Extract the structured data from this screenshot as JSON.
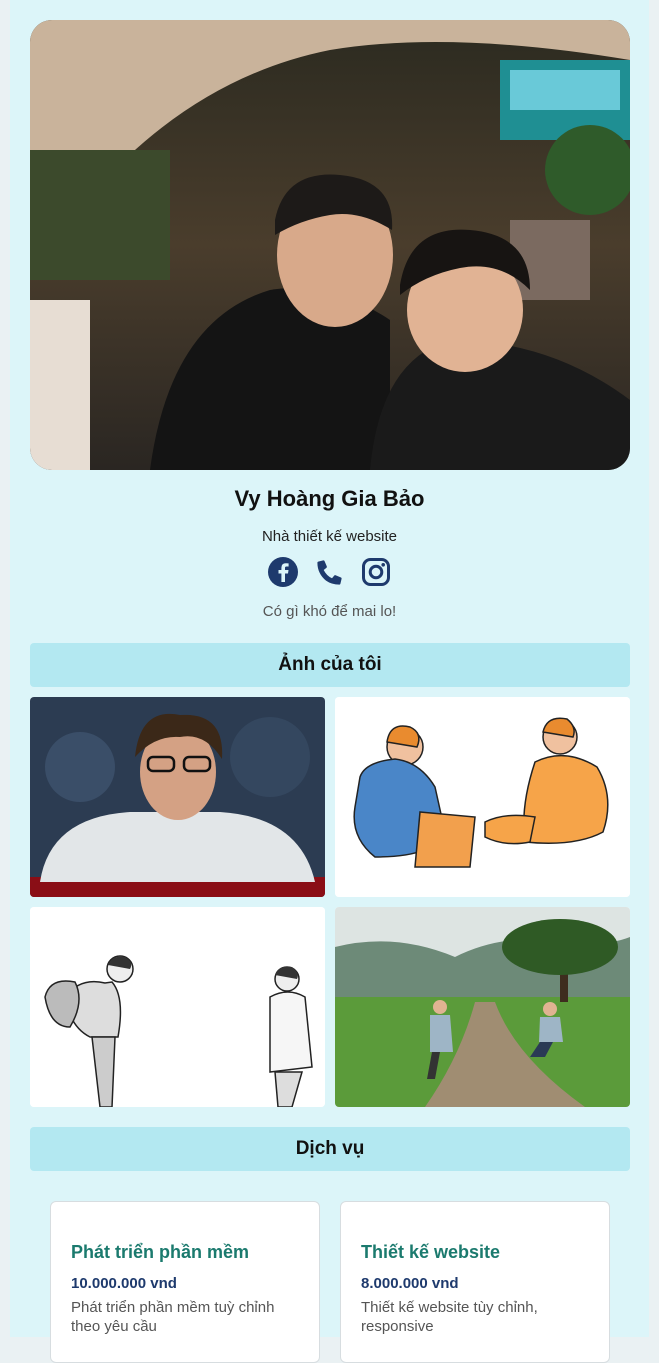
{
  "profile": {
    "name": "Vy Hoàng Gia Bảo",
    "role": "Nhà thiết kế website",
    "tagline": "Có gì khó để mai lo!",
    "cover_photo": "selfie-cafe-photo"
  },
  "socials": [
    {
      "icon": "facebook-icon"
    },
    {
      "icon": "phone-icon"
    },
    {
      "icon": "instagram-icon"
    }
  ],
  "colors": {
    "page_bg": "#dcf5f9",
    "section_header_bg": "#b3e8f1",
    "icon_color": "#1e3a6d",
    "service_title_color": "#1b7a6e",
    "price_color": "#1e3a6d"
  },
  "sections": {
    "photos_title": "Ảnh của tôi",
    "services_title": "Dịch vụ"
  },
  "gallery": [
    {
      "image": "portrait-glasses-photo"
    },
    {
      "image": "two-people-talking-illustration"
    },
    {
      "image": "two-people-sketch-illustration"
    },
    {
      "image": "countryside-path-photo"
    }
  ],
  "services": [
    {
      "title": "Phát triển phần mềm",
      "price": "10.000.000 vnd",
      "description": "Phát triển phần mềm tuỳ chỉnh theo yêu cầu"
    },
    {
      "title": "Thiết kế website",
      "price": "8.000.000 vnd",
      "description": "Thiết kế website tùy chỉnh, responsive"
    }
  ]
}
